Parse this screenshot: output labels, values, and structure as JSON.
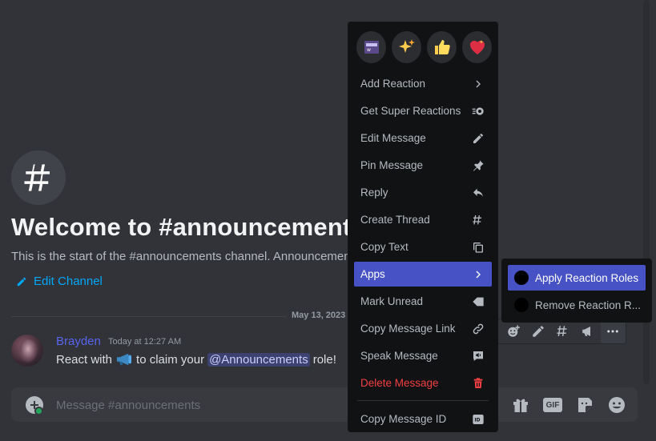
{
  "welcome": {
    "title": "Welcome to #announcements",
    "description": "This is the start of the #announcements channel. Announcements",
    "edit_channel": "Edit Channel"
  },
  "divider": {
    "date": "May 13, 2023"
  },
  "message": {
    "author": "Brayden",
    "timestamp": "Today at 12:27 AM",
    "text_before": "React with",
    "text_middle": "to claim your",
    "mention": "@Announcements",
    "text_after": "role!",
    "emoji": "megaphone-icon"
  },
  "composer": {
    "placeholder": "Message #announcements"
  },
  "context_menu": {
    "quick_reactions": [
      "custom-emoji",
      "sparkles",
      "thumbs-up",
      "heart-with-sparkles"
    ],
    "items": [
      {
        "label": "Add Reaction",
        "icon": "chevron-right-icon"
      },
      {
        "label": "Get Super Reactions",
        "icon": "super-reaction-icon"
      },
      {
        "label": "Edit Message",
        "icon": "pencil-icon"
      },
      {
        "label": "Pin Message",
        "icon": "pin-icon"
      },
      {
        "label": "Reply",
        "icon": "reply-icon"
      },
      {
        "label": "Create Thread",
        "icon": "thread-icon"
      },
      {
        "label": "Copy Text",
        "icon": "copy-icon"
      },
      {
        "label": "Apps",
        "icon": "chevron-right-icon"
      },
      {
        "label": "Mark Unread",
        "icon": "mark-unread-icon"
      },
      {
        "label": "Copy Message Link",
        "icon": "link-icon"
      },
      {
        "label": "Speak Message",
        "icon": "speak-icon"
      },
      {
        "label": "Delete Message",
        "icon": "trash-icon"
      },
      {
        "label": "Copy Message ID",
        "icon": "id-icon"
      }
    ]
  },
  "apps_submenu": {
    "items": [
      {
        "label": "Apply Reaction Roles"
      },
      {
        "label": "Remove Reaction R..."
      }
    ]
  },
  "colors": {
    "background": "#313338",
    "menu_bg": "#111214",
    "accent": "#4752c4",
    "danger": "#f23f42",
    "link": "#00a8fc",
    "author": "#5865f2"
  }
}
